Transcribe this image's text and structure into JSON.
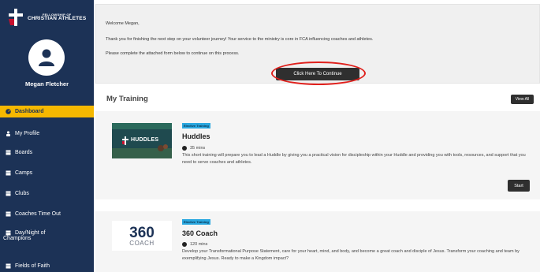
{
  "sidebar": {
    "logo_small": "FELLOWSHIP OF",
    "logo_big": "CHRISTIAN ATHLETES",
    "username": "Megan Fletcher",
    "items": [
      {
        "label": "Dashboard",
        "icon": "gauge-icon",
        "active": true
      },
      {
        "label": "My Profile",
        "icon": "person-icon"
      },
      {
        "label": "Boards",
        "icon": "grid-icon"
      },
      {
        "label": "Camps",
        "icon": "grid-icon"
      },
      {
        "label": "Clubs",
        "icon": "grid-icon"
      },
      {
        "label": "Coaches Time Out",
        "icon": "grid-icon"
      },
      {
        "label": "Day/Night of",
        "label2": "Champions",
        "icon": "grid-icon"
      },
      {
        "label": "Fields of Faith",
        "icon": "grid-icon"
      }
    ]
  },
  "welcome": {
    "greeting": "Welcome Megan,",
    "line1": "Thank you for finishing the next step on your volunteer journey! Your service to the ministry is core in FCA influencing coaches and athletes.",
    "line2": "Please complete the attached form below to continue on this process.",
    "continue_label": "Click Here To Continue"
  },
  "training": {
    "title": "My Training",
    "view_all": "View All",
    "courses": [
      {
        "badge": "Elective Training",
        "title": "Huddles",
        "thumb_text": "HUDDLES",
        "mins": "35 mins",
        "desc": "This short training will prepare you to lead a Huddle by giving you a practical vision for discipleship within your Huddle and providing you with tools, resources, and support that you need to serve coaches and athletes.",
        "start": "Start"
      },
      {
        "badge": "Elective Training",
        "title": "360 Coach",
        "thumb_big": "360",
        "thumb_small": "COACH",
        "mins": "120 mins",
        "desc": "Develop your Transformational Purpose Statement, care for your heart, mind, and body, and become a great coach and disciple of Jesus. Transform your coaching and team by exemplifying Jesus. Ready to make a Kingdom impact?"
      }
    ]
  },
  "colors": {
    "sidebar": "#1c3256",
    "active": "#f5b800",
    "badge": "#2ba8e0",
    "button": "#2f2f2f",
    "highlight": "#e0201c"
  }
}
